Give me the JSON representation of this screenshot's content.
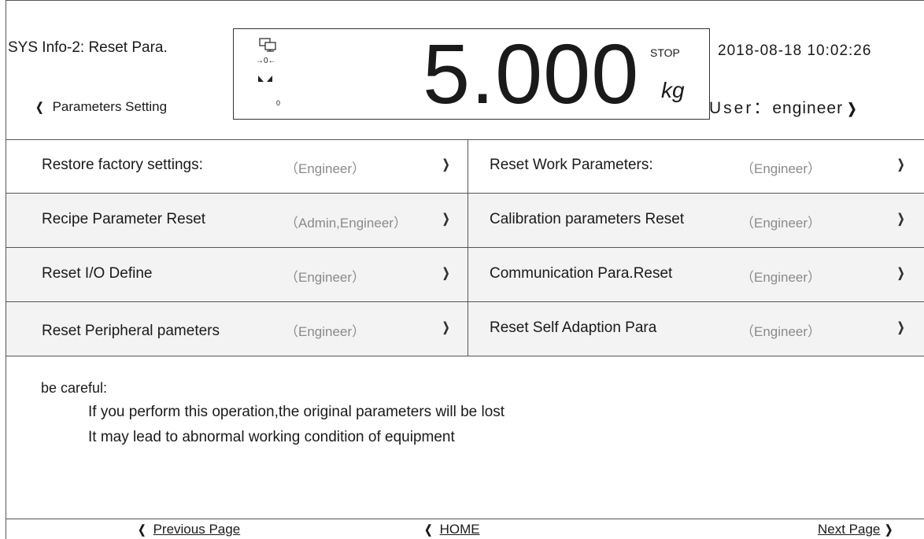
{
  "header": {
    "title": "SYS Info-2: Reset Para.",
    "back_label": "Parameters Setting",
    "zero_indicator": "→0←",
    "small_zero": "0",
    "weight": "5.000",
    "status": "STOP",
    "unit": "kg",
    "datetime": "2018-08-18 10:02:26",
    "user_label": "User：",
    "user_name": "engineer"
  },
  "icons": {
    "chevron_left": "❮",
    "chevron_right": "❯",
    "row_arrow": "❯"
  },
  "items": [
    {
      "left": {
        "name": "Restore factory settings:",
        "role": "（Engineer）"
      },
      "right": {
        "name": "Reset Work Parameters:",
        "role": "（Engineer）"
      }
    },
    {
      "left": {
        "name": "Recipe Parameter Reset",
        "role": "（Admin,Engineer）"
      },
      "right": {
        "name": "Calibration parameters Reset",
        "role": "（Engineer）"
      }
    },
    {
      "left": {
        "name": "Reset I/O Define",
        "role": "（Engineer）"
      },
      "right": {
        "name": "Communication Para.Reset",
        "role": "（Engineer）"
      }
    },
    {
      "left": {
        "name": "Reset Peripheral pameters",
        "role": "（Engineer）"
      },
      "right": {
        "name": "Reset Self Adaption Para",
        "role": "（Engineer）"
      }
    }
  ],
  "warning": {
    "title": "be careful:",
    "lines": [
      "If you perform this operation,the original parameters will be lost",
      "It may lead to abnormal working condition of equipment"
    ]
  },
  "footer": {
    "previous": "Previous Page",
    "home": "HOME",
    "next": "Next Page"
  },
  "colors": {
    "border": "#555555",
    "role_text": "#8a8a8a",
    "shaded_row": "#f3f3f3"
  }
}
